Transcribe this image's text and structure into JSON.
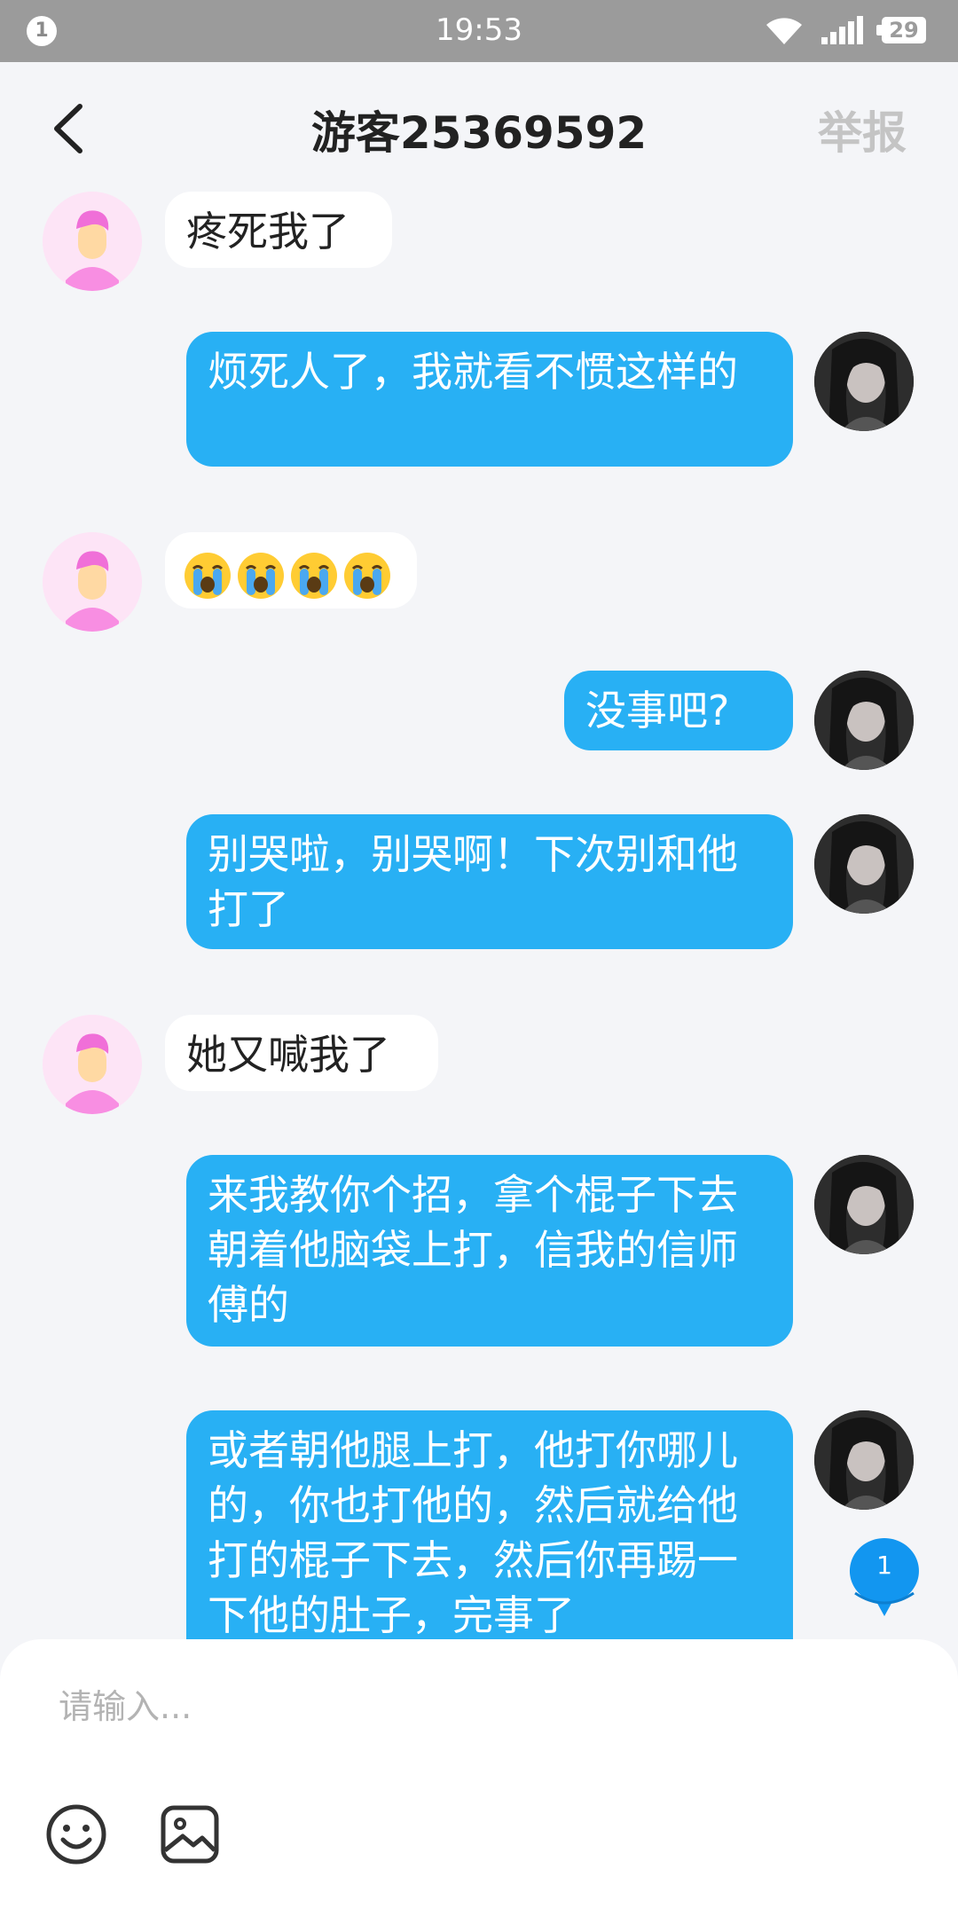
{
  "status_bar": {
    "notification_count": "1",
    "time": "19:53",
    "battery": "29"
  },
  "header": {
    "title": "游客25369592",
    "report_label": "举报"
  },
  "messages": [
    {
      "side": "in",
      "text": "疼死我了"
    },
    {
      "side": "out",
      "text": "烦死人了，我就看不惯这样的"
    },
    {
      "side": "in",
      "emoji": "crying-face",
      "count": 4
    },
    {
      "side": "out",
      "text": "没事吧?"
    },
    {
      "side": "out",
      "text": "别哭啦，别哭啊！下次别和他打了"
    },
    {
      "side": "in",
      "text": "她又喊我了"
    },
    {
      "side": "out",
      "text": "来我教你个招，拿个棍子下去朝着他脑袋上打，信我的信师傅的"
    },
    {
      "side": "out",
      "text": "或者朝他腿上打，他打你哪儿的，你也打他的，然后就给他打的棍子下去，然后你再踢一下他的肚子，完事了"
    }
  ],
  "unread_badge": "1",
  "input": {
    "placeholder": "请输入..."
  },
  "toolbar": {
    "icons": [
      "smiley-icon",
      "image-icon"
    ]
  },
  "colors": {
    "out_bubble": "#28b0f4",
    "in_bubble": "#ffffff",
    "background": "#f4f5f8",
    "badge": "#1296f0"
  }
}
